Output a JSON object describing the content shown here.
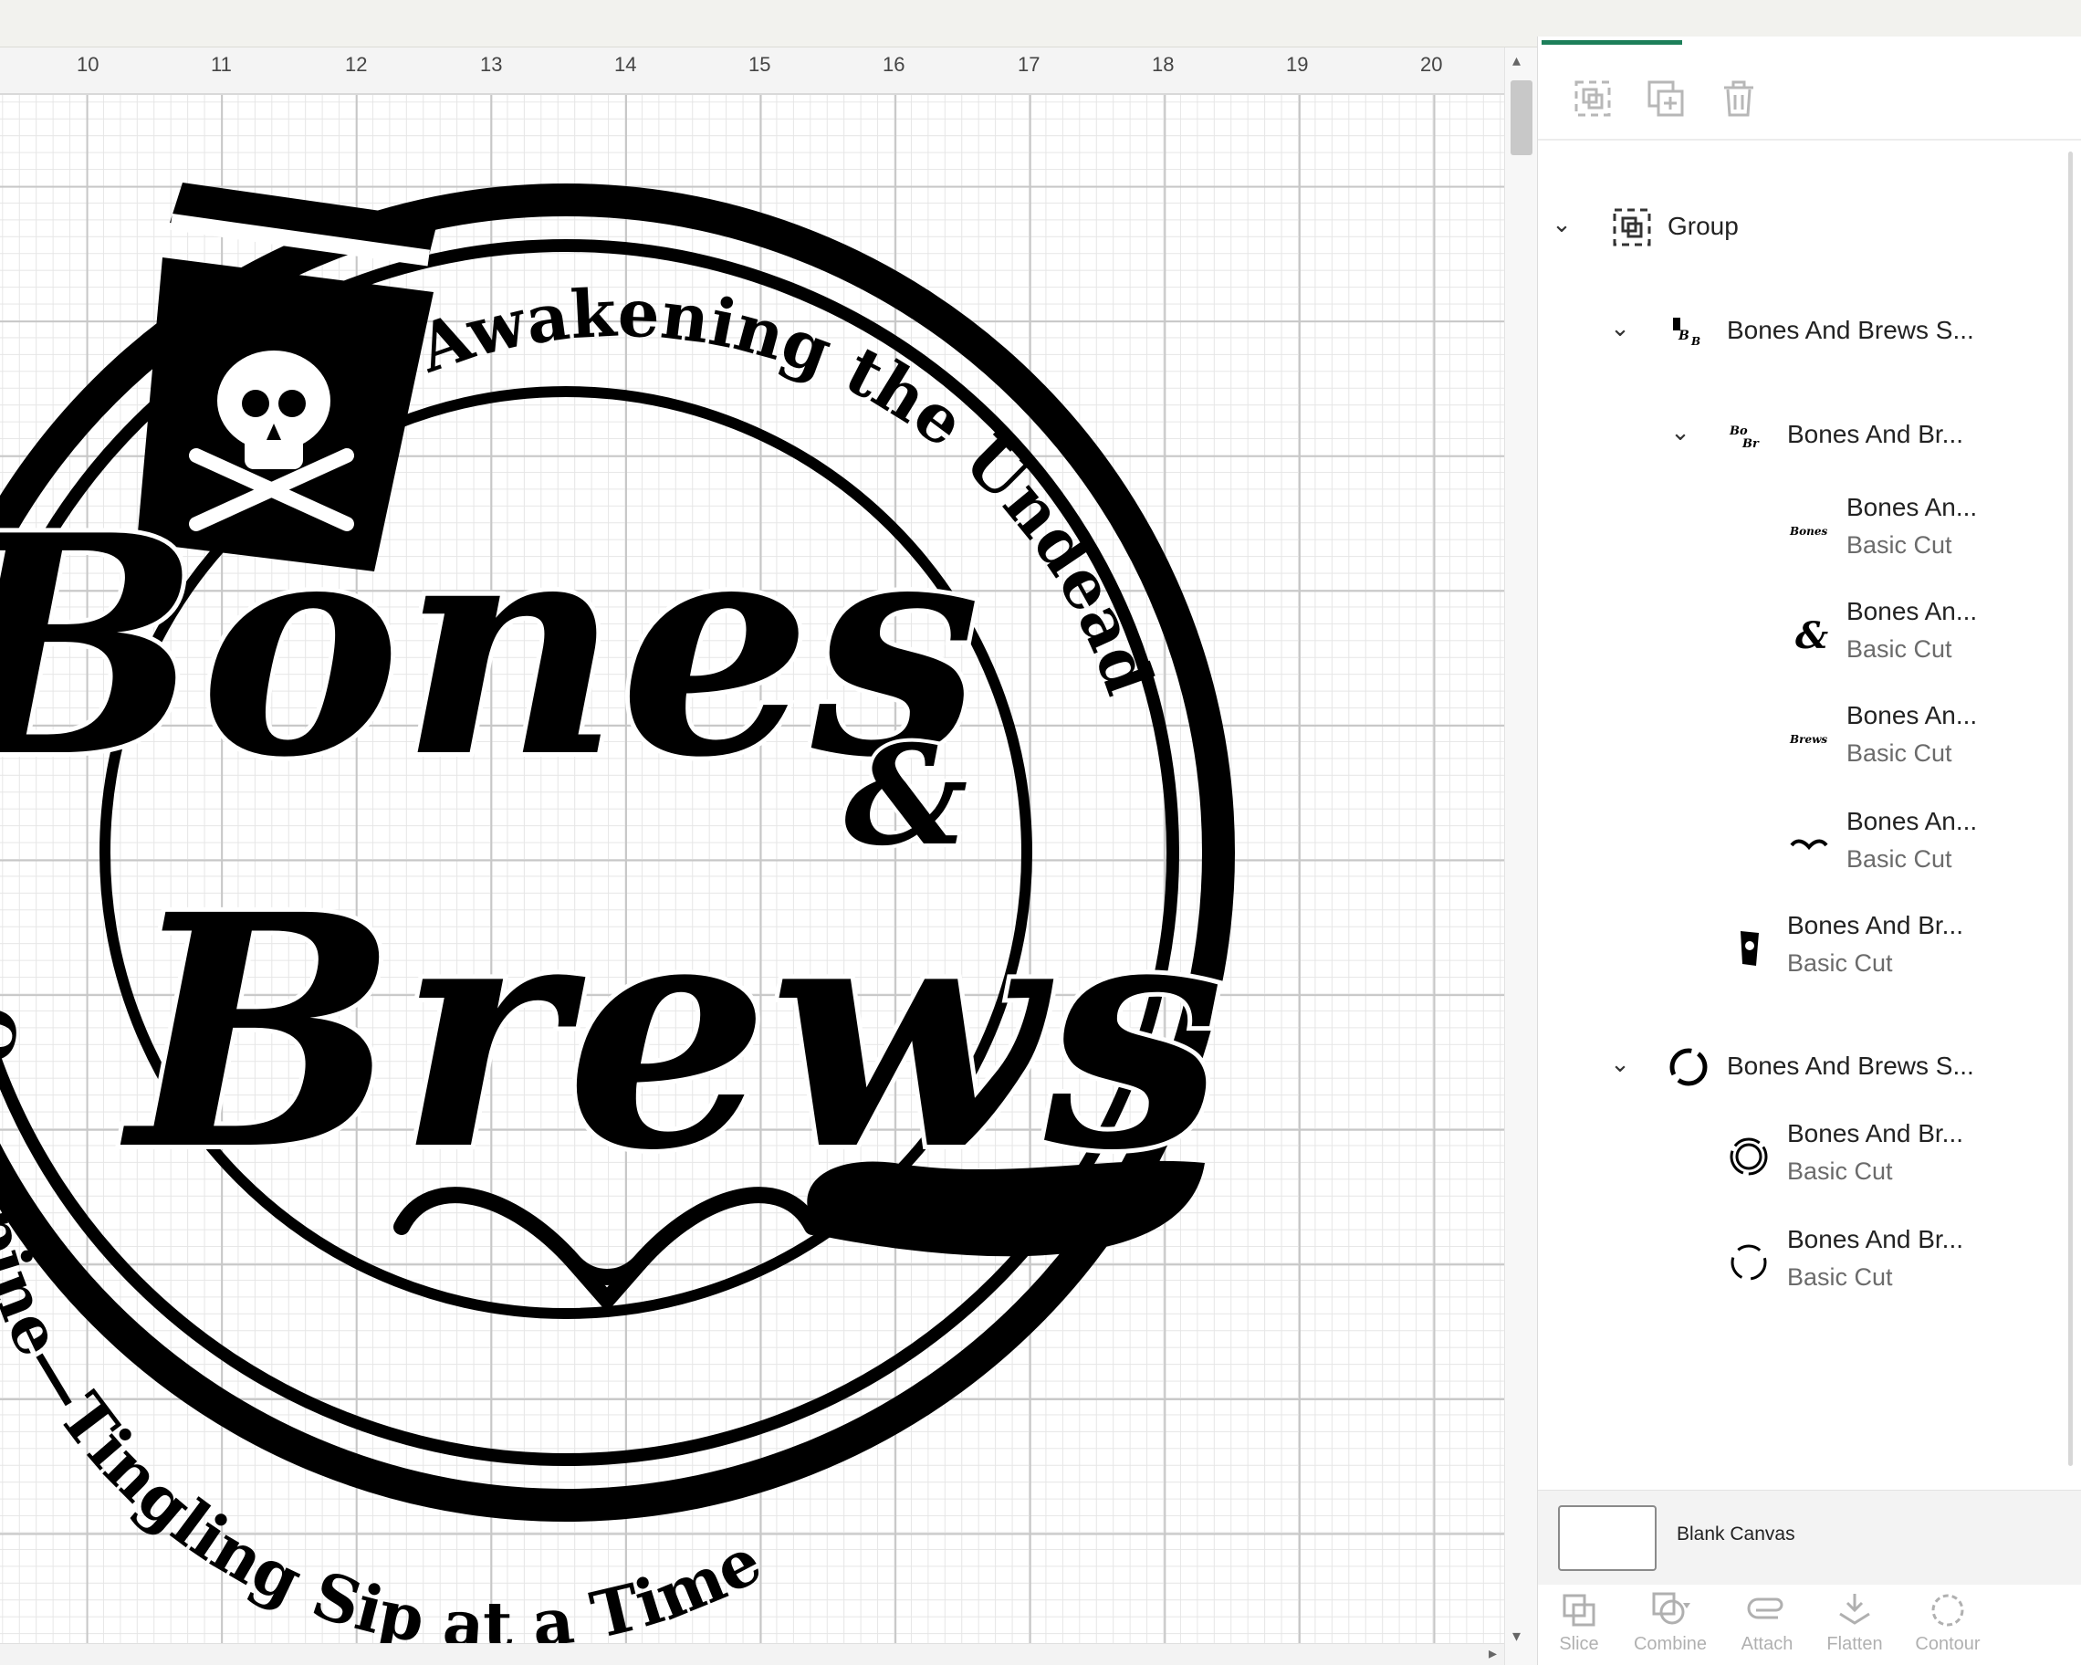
{
  "ruler": {
    "labels": [
      "10",
      "11",
      "12",
      "13",
      "14",
      "15",
      "16",
      "17",
      "18",
      "19",
      "20"
    ]
  },
  "artwork": {
    "main_word_1": "Bones",
    "ampersand": "&",
    "main_word_2": "Brews",
    "arc_top": "Awakening the Undead",
    "arc_bottom": "One Spine—Tingling Sip at a Time"
  },
  "panel": {
    "toolbar_icons": [
      "group-icon",
      "duplicate-icon",
      "delete-icon"
    ],
    "layers": [
      {
        "name": "Group",
        "sub": ""
      },
      {
        "name": "Bones And Brews S...",
        "sub": ""
      },
      {
        "name": "Bones And Br...",
        "sub": ""
      },
      {
        "name": "Bones An...",
        "sub": "Basic Cut"
      },
      {
        "name": "Bones An...",
        "sub": "Basic Cut"
      },
      {
        "name": "Bones An...",
        "sub": "Basic Cut"
      },
      {
        "name": "Bones An...",
        "sub": "Basic Cut"
      },
      {
        "name": "Bones And Br...",
        "sub": "Basic Cut"
      },
      {
        "name": "Bones And Brews S...",
        "sub": ""
      },
      {
        "name": "Bones And Br...",
        "sub": "Basic Cut"
      },
      {
        "name": "Bones And Br...",
        "sub": "Basic Cut"
      }
    ],
    "blank_canvas_label": "Blank Canvas",
    "bottom_tools": [
      "Slice",
      "Combine",
      "Attach",
      "Flatten",
      "Contour"
    ]
  },
  "colors": {
    "accent": "#1d7f5a",
    "ink": "#000000"
  }
}
